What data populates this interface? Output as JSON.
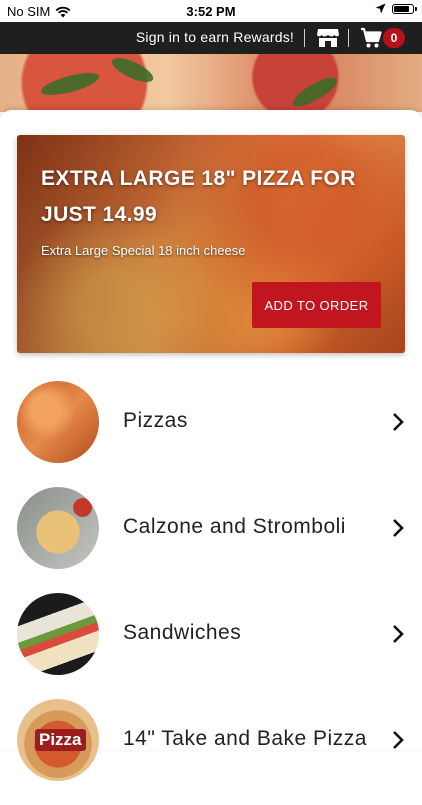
{
  "status_bar": {
    "carrier": "No SIM",
    "time": "3:52 PM"
  },
  "topbar": {
    "rewards_text": "Sign in to earn Rewards!",
    "cart_count": "0"
  },
  "promo": {
    "title": "EXTRA LARGE 18\" PIZZA FOR JUST 14.99",
    "description": "Extra Large Special 18 inch cheese",
    "button_label": "ADD TO ORDER"
  },
  "categories": [
    {
      "label": "Pizzas"
    },
    {
      "label": "Calzone and Stromboli"
    },
    {
      "label": "Sandwiches"
    },
    {
      "label": "14\" Take and Bake Pizza",
      "thumb_text": "Pizza"
    }
  ],
  "colors": {
    "brand_red": "#c1151f",
    "topbar_bg": "#1f1f1f"
  }
}
